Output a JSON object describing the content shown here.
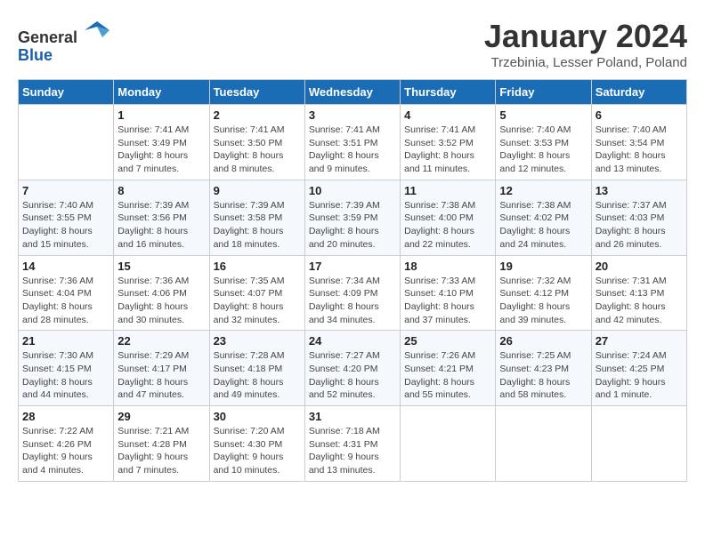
{
  "logo": {
    "general": "General",
    "blue": "Blue"
  },
  "title": "January 2024",
  "subtitle": "Trzebinia, Lesser Poland, Poland",
  "days_of_week": [
    "Sunday",
    "Monday",
    "Tuesday",
    "Wednesday",
    "Thursday",
    "Friday",
    "Saturday"
  ],
  "weeks": [
    [
      {
        "day": "",
        "info": ""
      },
      {
        "day": "1",
        "info": "Sunrise: 7:41 AM\nSunset: 3:49 PM\nDaylight: 8 hours\nand 7 minutes."
      },
      {
        "day": "2",
        "info": "Sunrise: 7:41 AM\nSunset: 3:50 PM\nDaylight: 8 hours\nand 8 minutes."
      },
      {
        "day": "3",
        "info": "Sunrise: 7:41 AM\nSunset: 3:51 PM\nDaylight: 8 hours\nand 9 minutes."
      },
      {
        "day": "4",
        "info": "Sunrise: 7:41 AM\nSunset: 3:52 PM\nDaylight: 8 hours\nand 11 minutes."
      },
      {
        "day": "5",
        "info": "Sunrise: 7:40 AM\nSunset: 3:53 PM\nDaylight: 8 hours\nand 12 minutes."
      },
      {
        "day": "6",
        "info": "Sunrise: 7:40 AM\nSunset: 3:54 PM\nDaylight: 8 hours\nand 13 minutes."
      }
    ],
    [
      {
        "day": "7",
        "info": "Sunrise: 7:40 AM\nSunset: 3:55 PM\nDaylight: 8 hours\nand 15 minutes."
      },
      {
        "day": "8",
        "info": "Sunrise: 7:39 AM\nSunset: 3:56 PM\nDaylight: 8 hours\nand 16 minutes."
      },
      {
        "day": "9",
        "info": "Sunrise: 7:39 AM\nSunset: 3:58 PM\nDaylight: 8 hours\nand 18 minutes."
      },
      {
        "day": "10",
        "info": "Sunrise: 7:39 AM\nSunset: 3:59 PM\nDaylight: 8 hours\nand 20 minutes."
      },
      {
        "day": "11",
        "info": "Sunrise: 7:38 AM\nSunset: 4:00 PM\nDaylight: 8 hours\nand 22 minutes."
      },
      {
        "day": "12",
        "info": "Sunrise: 7:38 AM\nSunset: 4:02 PM\nDaylight: 8 hours\nand 24 minutes."
      },
      {
        "day": "13",
        "info": "Sunrise: 7:37 AM\nSunset: 4:03 PM\nDaylight: 8 hours\nand 26 minutes."
      }
    ],
    [
      {
        "day": "14",
        "info": "Sunrise: 7:36 AM\nSunset: 4:04 PM\nDaylight: 8 hours\nand 28 minutes."
      },
      {
        "day": "15",
        "info": "Sunrise: 7:36 AM\nSunset: 4:06 PM\nDaylight: 8 hours\nand 30 minutes."
      },
      {
        "day": "16",
        "info": "Sunrise: 7:35 AM\nSunset: 4:07 PM\nDaylight: 8 hours\nand 32 minutes."
      },
      {
        "day": "17",
        "info": "Sunrise: 7:34 AM\nSunset: 4:09 PM\nDaylight: 8 hours\nand 34 minutes."
      },
      {
        "day": "18",
        "info": "Sunrise: 7:33 AM\nSunset: 4:10 PM\nDaylight: 8 hours\nand 37 minutes."
      },
      {
        "day": "19",
        "info": "Sunrise: 7:32 AM\nSunset: 4:12 PM\nDaylight: 8 hours\nand 39 minutes."
      },
      {
        "day": "20",
        "info": "Sunrise: 7:31 AM\nSunset: 4:13 PM\nDaylight: 8 hours\nand 42 minutes."
      }
    ],
    [
      {
        "day": "21",
        "info": "Sunrise: 7:30 AM\nSunset: 4:15 PM\nDaylight: 8 hours\nand 44 minutes."
      },
      {
        "day": "22",
        "info": "Sunrise: 7:29 AM\nSunset: 4:17 PM\nDaylight: 8 hours\nand 47 minutes."
      },
      {
        "day": "23",
        "info": "Sunrise: 7:28 AM\nSunset: 4:18 PM\nDaylight: 8 hours\nand 49 minutes."
      },
      {
        "day": "24",
        "info": "Sunrise: 7:27 AM\nSunset: 4:20 PM\nDaylight: 8 hours\nand 52 minutes."
      },
      {
        "day": "25",
        "info": "Sunrise: 7:26 AM\nSunset: 4:21 PM\nDaylight: 8 hours\nand 55 minutes."
      },
      {
        "day": "26",
        "info": "Sunrise: 7:25 AM\nSunset: 4:23 PM\nDaylight: 8 hours\nand 58 minutes."
      },
      {
        "day": "27",
        "info": "Sunrise: 7:24 AM\nSunset: 4:25 PM\nDaylight: 9 hours\nand 1 minute."
      }
    ],
    [
      {
        "day": "28",
        "info": "Sunrise: 7:22 AM\nSunset: 4:26 PM\nDaylight: 9 hours\nand 4 minutes."
      },
      {
        "day": "29",
        "info": "Sunrise: 7:21 AM\nSunset: 4:28 PM\nDaylight: 9 hours\nand 7 minutes."
      },
      {
        "day": "30",
        "info": "Sunrise: 7:20 AM\nSunset: 4:30 PM\nDaylight: 9 hours\nand 10 minutes."
      },
      {
        "day": "31",
        "info": "Sunrise: 7:18 AM\nSunset: 4:31 PM\nDaylight: 9 hours\nand 13 minutes."
      },
      {
        "day": "",
        "info": ""
      },
      {
        "day": "",
        "info": ""
      },
      {
        "day": "",
        "info": ""
      }
    ]
  ]
}
